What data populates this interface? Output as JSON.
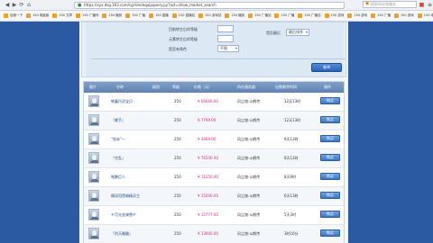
{
  "browser": {
    "url": "https://xyx.dsg.163.com/cgi-bin/equipquery.py?act=show_market_search",
    "search_placeholder": "搜索网站和服务",
    "nav": [
      "◀",
      "▶",
      "⟳",
      "⌂"
    ]
  },
  "bookmarks": [
    "百度一下",
    "150 电脑版",
    "150 文章",
    "150 广播列",
    "150 播放",
    "150 广播",
    "150 直播",
    "150 直播站",
    "150 游戏站",
    "150 播放",
    "150 广播站",
    "150 广播",
    "150 广播站",
    "150 游戏",
    "150 游戏",
    "150 广播",
    "150 游戏",
    "150 电游"
  ],
  "form": {
    "label1": "目前转生后的等级",
    "label2": "元素转生后的等级",
    "label3": "是否有角色",
    "select1": "不限",
    "label4": "是否最后",
    "select2": "最后排序",
    "query_label": "查询"
  },
  "table": {
    "headers": [
      "图片",
      "名称",
      "级别",
      "等级",
      "价格（元）",
      "所在服务器",
      "出售剩余时间",
      "操作"
    ],
    "rows": [
      {
        "name": "铁蘑丹灵宝贝",
        "level": "250",
        "price": "¥ 66666.00",
        "server": "风尘旅·斗鹤传",
        "time": "12天13时",
        "action": "购买"
      },
      {
        "name": "『紫手』",
        "level": "250",
        "price": "¥ 7799.00",
        "server": "风尘旅·斗鹤传",
        "time": "12天13时",
        "action": "购买"
      },
      {
        "name": "°怒赤°∽",
        "level": "250",
        "price": "¥ 2888.00",
        "server": "风尘旅·斗鹤传",
        "time": "9天13时",
        "action": "购买"
      },
      {
        "name": "『空乱』",
        "level": "250",
        "price": "¥ 76500.00",
        "server": "风尘旅·斗鹤传",
        "time": "8天12时",
        "action": "购买"
      },
      {
        "name": "铁鹏巨人",
        "level": "250",
        "price": "¥ 11250.00",
        "server": "风尘旅·斗鹤传",
        "time": "8天9时",
        "action": "购买"
      },
      {
        "name": "情深用黑暗精灵主",
        "level": "250",
        "price": "¥ 15000.00",
        "server": "风尘旅·斗鹤传",
        "time": "6天13时",
        "action": "购买"
      },
      {
        "name": "ヤ月光坐骑雪ヤ",
        "level": "250",
        "price": "¥ 15777.00",
        "server": "风尘旅·斗鹤传",
        "time": "5天3时",
        "action": "购买"
      },
      {
        "name": "『烈天霸霸』",
        "level": "250",
        "price": "¥ 13900.00",
        "server": "风尘旅·斗鹤传",
        "time": "3时16分",
        "action": "购买"
      }
    ]
  }
}
